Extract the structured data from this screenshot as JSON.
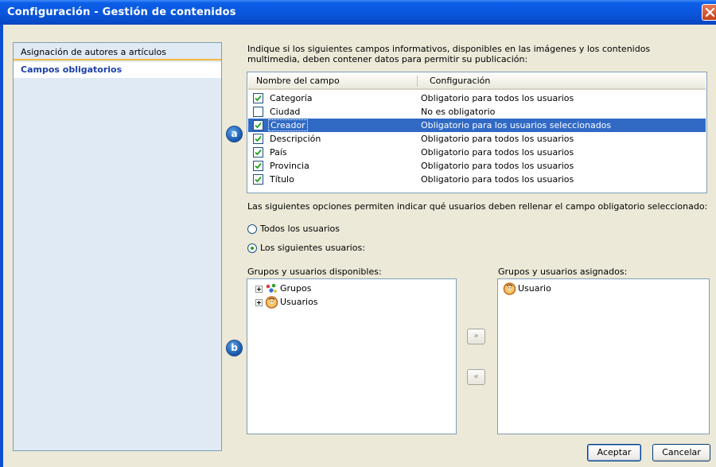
{
  "window": {
    "title": "Configuración - Gestión de contenidos",
    "close_icon": "close-icon",
    "close_color": "#d4512a"
  },
  "nav": {
    "items": [
      {
        "label": "Asignación de autores a artículos",
        "selected": false
      },
      {
        "label": "Campos obligatorios",
        "selected": true
      }
    ]
  },
  "main": {
    "intro": "Indique si los siguientes campos informativos, disponibles en las imágenes y los contenidos multimedia, deben contener datos para permitir su publicación:",
    "grid": {
      "columns": [
        "Nombre del campo",
        "Configuración"
      ],
      "rows": [
        {
          "name": "Categoría",
          "config": "Obligatorio para todos los usuarios",
          "checked": true,
          "selected": false
        },
        {
          "name": "Ciudad",
          "config": "No es obligatorio",
          "checked": false,
          "selected": false
        },
        {
          "name": "Creador",
          "config": "Obligatorio para los usuarios seleccionados",
          "checked": true,
          "selected": true
        },
        {
          "name": "Descripción",
          "config": "Obligatorio para todos los usuarios",
          "checked": true,
          "selected": false
        },
        {
          "name": "País",
          "config": "Obligatorio para todos los usuarios",
          "checked": true,
          "selected": false
        },
        {
          "name": "Provincia",
          "config": "Obligatorio para todos los usuarios",
          "checked": true,
          "selected": false
        },
        {
          "name": "Título",
          "config": "Obligatorio para todos los usuarios",
          "checked": true,
          "selected": false
        }
      ]
    },
    "badges": {
      "a": "a",
      "b": "b"
    },
    "options_desc": "Las siguientes opciones permiten indicar qué usuarios deben rellenar el campo obligatorio seleccionado:",
    "radio_all": "Todos los usuarios",
    "radio_following": "Los siguientes usuarios:",
    "radio_selected": "following",
    "available_label": "Grupos y usuarios disponibles:",
    "available_items": [
      {
        "label": "Grupos",
        "icon": "groups-icon"
      },
      {
        "label": "Usuarios",
        "icon": "users-icon"
      }
    ],
    "assigned_label": "Grupos y usuarios asignados:",
    "assigned_items": [
      {
        "label": "Usuario",
        "icon": "user-icon"
      }
    ],
    "add_button": "»",
    "remove_button": "«"
  },
  "footer": {
    "ok": "Aceptar",
    "cancel": "Cancelar"
  },
  "colors": {
    "title_bar": "#0a55d9",
    "selection": "#316ac5",
    "nav_background": "#dfeaf5",
    "nav_accent": "#f6b83a"
  }
}
